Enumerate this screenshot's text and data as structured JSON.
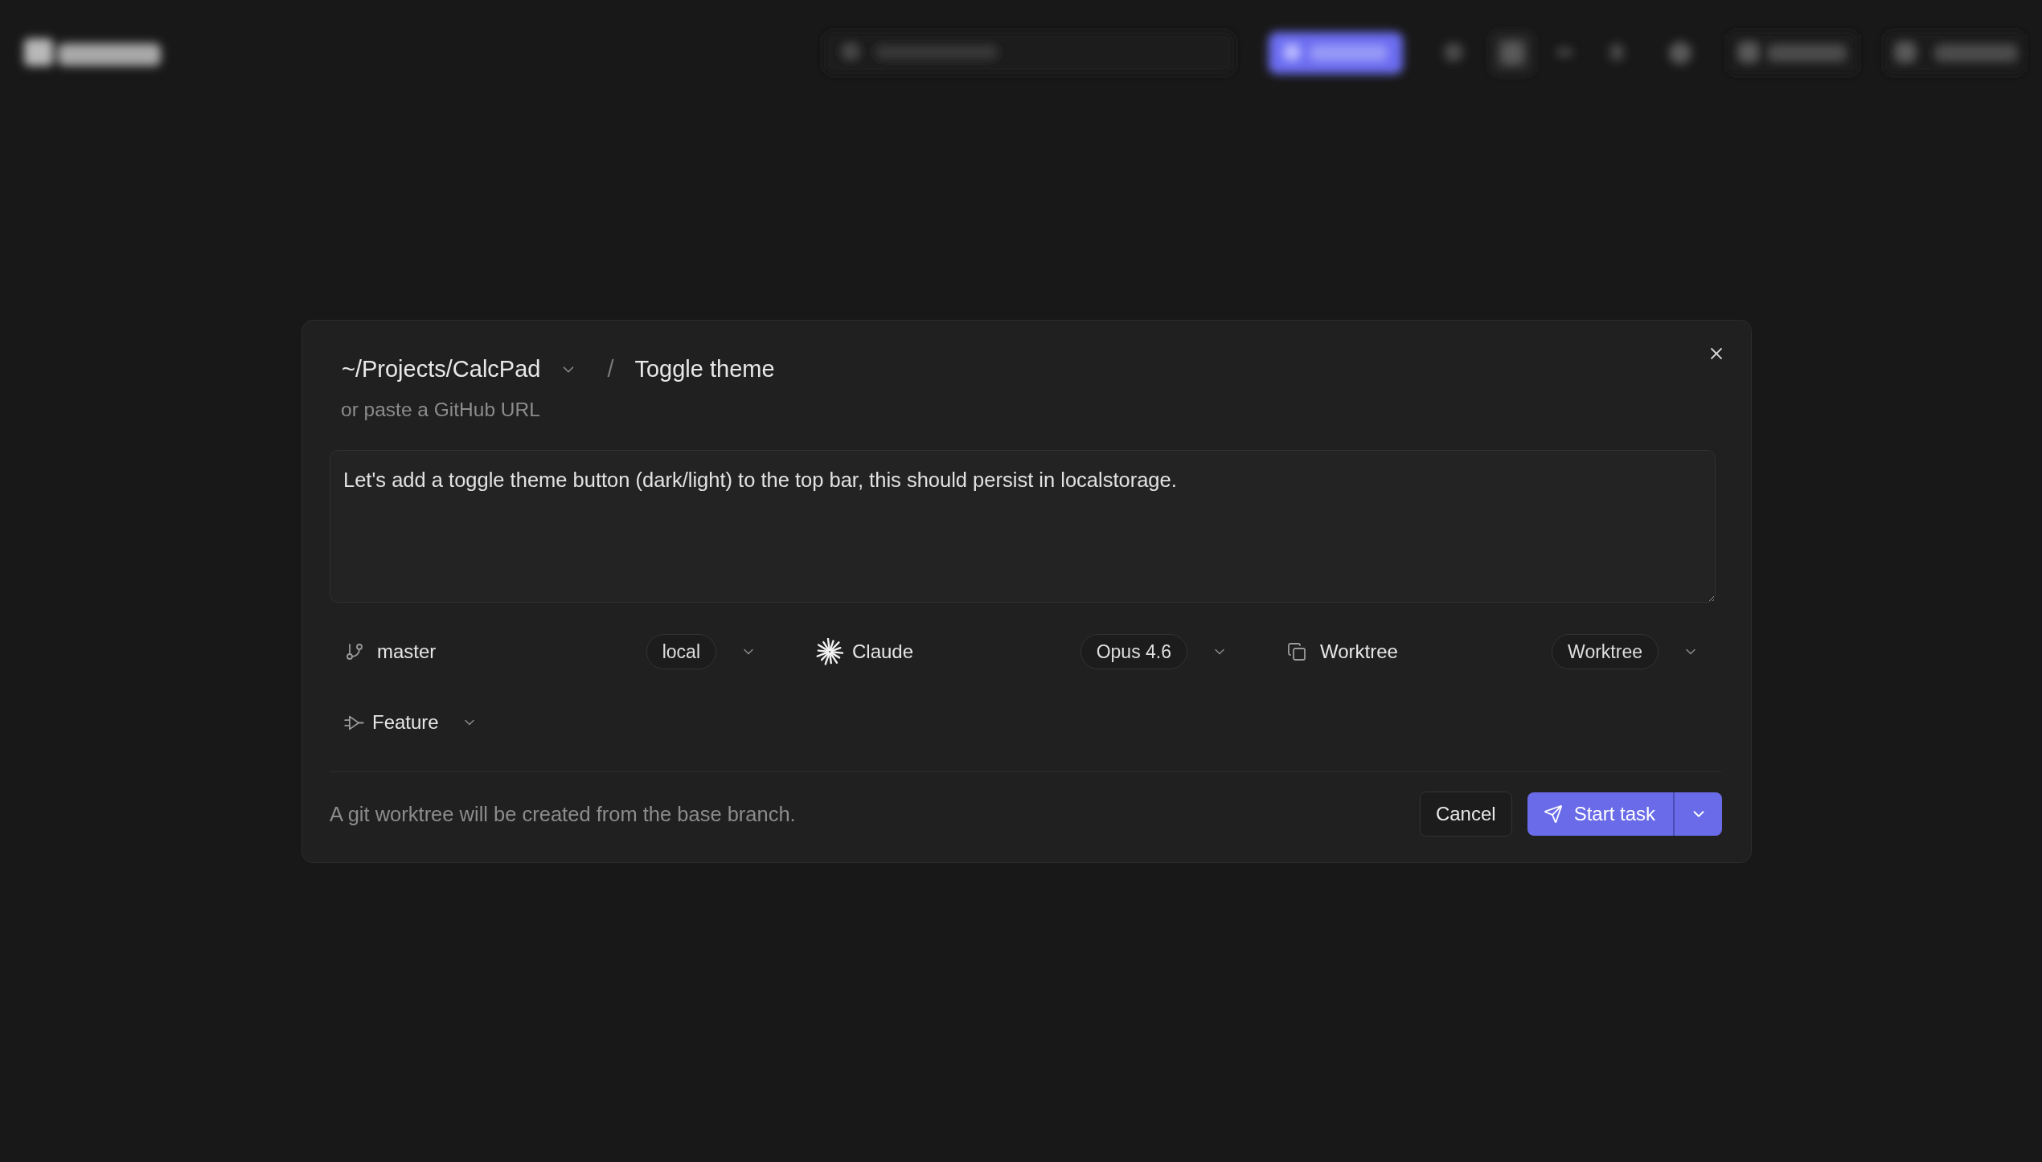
{
  "dialog": {
    "repository": "~/Projects/CalcPad",
    "separator": "/",
    "title": "Toggle theme",
    "hint": "or paste a GitHub URL",
    "prompt": {
      "value": "Let's add a toggle theme button (dark/light) to the top bar, this should persist in localstorage."
    },
    "options": [
      {
        "kind": "branch",
        "label": "master",
        "tag": "local"
      },
      {
        "kind": "agent",
        "label": "Claude",
        "tag": "Opus 4.6"
      },
      {
        "kind": "workspace",
        "label": "Worktree",
        "tag": "Worktree"
      }
    ],
    "task_type": {
      "label": "Feature"
    },
    "note": "A git worktree will be created from the base branch.",
    "buttons": {
      "cancel": "Cancel",
      "submit": "Start task"
    }
  }
}
